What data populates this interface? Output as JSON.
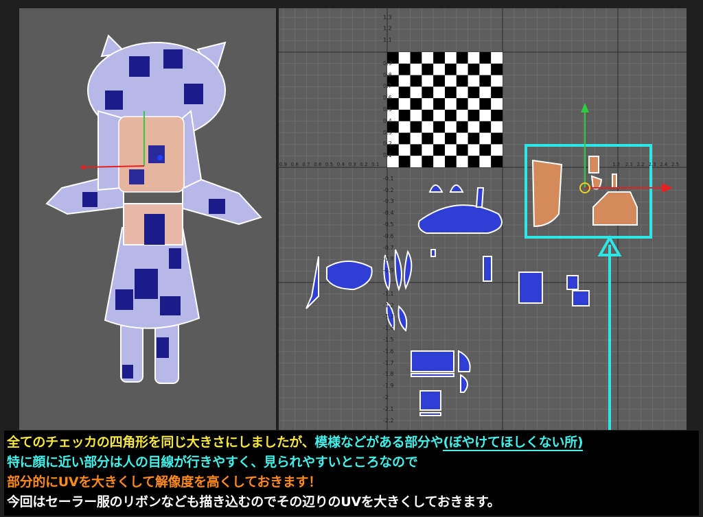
{
  "uv_editor": {
    "y_ticks": [
      "1.3",
      "1.2",
      "1.1",
      "0.9",
      "0.8",
      "0.7",
      "0.6",
      "0.5",
      "0.4",
      "0.3",
      "0.2",
      "0.1",
      "-0.1",
      "-0.2",
      "-0.3",
      "-0.4",
      "-0.5",
      "-0.6",
      "-0.7",
      "-0.8",
      "-0.9",
      "-1.1",
      "-1.2",
      "-1.3",
      "-1.4",
      "-1.5",
      "-1.6",
      "-1.7",
      "-1.8",
      "-1.9",
      "-2",
      "-2.1",
      "-2.2"
    ],
    "x_ticks_left": [
      "0.9",
      "0.8",
      "0.7",
      "0.6",
      "0.5",
      "0.4",
      "0.3",
      "0.2",
      "0.1"
    ],
    "x_ticks_right": [
      "2.1",
      "2.2",
      "2.3",
      "2.4",
      "2.5"
    ],
    "checker_labels": [
      "0.9",
      "0.8",
      "0.7",
      "0.6",
      "0.5",
      "0.4",
      "0.3",
      "0.2",
      "0.1",
      "0",
      "0.1",
      "0.2",
      "0.3",
      "0.4",
      "0.5",
      "0.6",
      "0.7",
      "0.8",
      "0.9"
    ],
    "manipulator_value": "1.2"
  },
  "caption": {
    "line1_part1": "全てのチェッカの四角形を同じ大きさにしましたが、",
    "line1_part2": "模様などがある部分や",
    "line1_part3": "(ぼやけてほしくない所)",
    "line2": "特に顔に近い部分は人の目線が行きやすく、見られやすいところなので",
    "line3": "部分的にUVを大きくして解像度を高くしておきます！",
    "line4": "今回はセーラー服のリボンなども描き込むのでその辺りのUVを大きくしておきます。"
  },
  "colors": {
    "caption_yellow": "#f5e642",
    "caption_cyan": "#43f0ea",
    "caption_orange": "#ff8a1c",
    "uv_shell_blue": "#2f3fd6",
    "highlight_box": "#2fe6e6"
  }
}
